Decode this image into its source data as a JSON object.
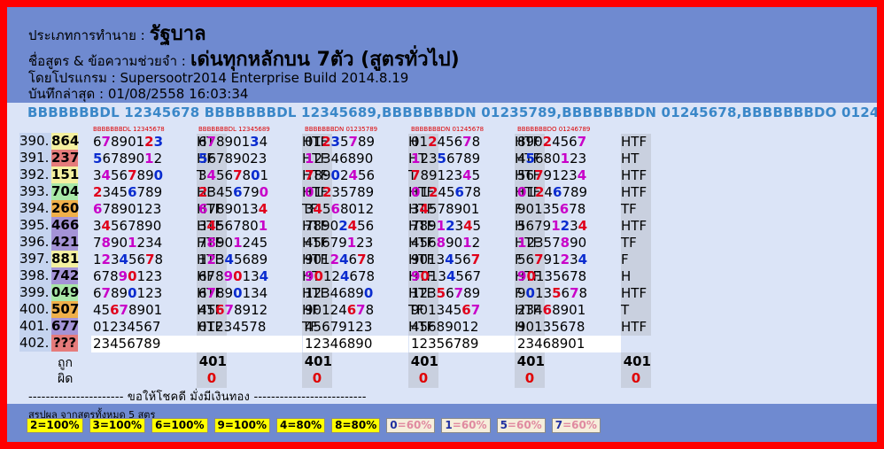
{
  "header": {
    "type_label": "ประเภทการทำนาย :",
    "type_value": "รัฐบาล",
    "formula_label": "ชื่อสูตร & ข้อความช่วยจำ :",
    "formula_value": "เด่นทุกหลักบน 7ตัว (สูตรทั่วไป)",
    "program_label": "โดยโปรแกรม :",
    "program_value": "Supersootr2014 Enterprise Build 2014.8.19",
    "saved_label": "บันทึกล่าสุด :",
    "saved_value": "01/08/2558 16:03:34"
  },
  "formula_line": "BBBBBBBDL 12345678 BBBBBBBDL 12345689,BBBBBBBDN 01235789,BBBBBBBDN 01245678,BBBBBBBDO 01246789",
  "rows": [
    {
      "idx": "390.",
      "pred": "864",
      "color": "#f4f0a0"
    },
    {
      "idx": "391.",
      "pred": "237",
      "color": "#e57b7b"
    },
    {
      "idx": "392.",
      "pred": "151",
      "color": "#f4f0a0"
    },
    {
      "idx": "393.",
      "pred": "704",
      "color": "#a9e8a8"
    },
    {
      "idx": "394.",
      "pred": "260",
      "color": "#f0b04a"
    },
    {
      "idx": "395.",
      "pred": "466",
      "color": "#a493d6"
    },
    {
      "idx": "396.",
      "pred": "421",
      "color": "#a493d6"
    },
    {
      "idx": "397.",
      "pred": "881",
      "color": "#f4f0a0"
    },
    {
      "idx": "398.",
      "pred": "742",
      "color": "#a493d6"
    },
    {
      "idx": "399.",
      "pred": "049",
      "color": "#a9e8a8"
    },
    {
      "idx": "400.",
      "pred": "507",
      "color": "#f0b04a"
    },
    {
      "idx": "401.",
      "pred": "677",
      "color": "#a493d6"
    },
    {
      "idx": "402.",
      "pred": "???",
      "color": "#e57b7b"
    }
  ],
  "columns": [
    {
      "head": "BBBBBBBDL 12345678",
      "digits": [
        "67890123",
        "56789012",
        "34567890",
        "23456789",
        "67890123",
        "34567890",
        "78901234",
        "12345678",
        "67890123",
        "67890123",
        "45678901",
        "01234567",
        "23456789"
      ],
      "results": [
        "HT",
        "HF",
        "T",
        "HF",
        "HTF",
        "HTF",
        "HTF",
        "HTF",
        "HF",
        "HTF",
        "HTF",
        "HTF",
        ""
      ],
      "total": "401",
      "wrong": "0"
    },
    {
      "head": "BBBBBBBDL 12345689",
      "digits": [
        "67890134",
        "56789023",
        "34567801",
        "23456790",
        "67890134",
        "34567801",
        "78901245",
        "12345689",
        "67890134",
        "67890134",
        "45678912",
        "01234578",
        ""
      ],
      "results": [
        "HTF",
        "HTF",
        "HTF",
        "HTF",
        "TF",
        "HTF",
        "HTF",
        "HTF",
        "HT",
        "HTF",
        "HF",
        "TF",
        ""
      ],
      "total": "401",
      "wrong": "0"
    },
    {
      "head": "BBBBBBBDN 01235789",
      "digits": [
        "01235789",
        "12346890",
        "78902456",
        "01235789",
        "34568012",
        "78902456",
        "45679123",
        "90124678",
        "90124678",
        "12346890",
        "90124678",
        "45679123",
        "12346890"
      ],
      "results": [
        "H",
        "HT",
        "T",
        "HTF",
        "HTF",
        "HTF",
        "HTF",
        "HTF",
        "HTF",
        "HTF",
        "TF",
        "HTF",
        ""
      ],
      "total": "401",
      "wrong": "0"
    },
    {
      "head": "BBBBBBBDN 01245678",
      "digits": [
        "01245678",
        "12356789",
        "78912345",
        "01245678",
        "34578901",
        "78912345",
        "45689012",
        "90134567",
        "90134567",
        "12356789",
        "90134567",
        "45689012",
        "12356789"
      ],
      "results": [
        "HTF",
        "HTF",
        "HTF",
        "HTF",
        "F",
        "H",
        "HTF",
        "F",
        "HTF",
        "F",
        "HTF",
        "H",
        ""
      ],
      "total": "401",
      "wrong": "0"
    },
    {
      "head": "BBBBBBBDO 01246789",
      "digits": [
        "89024567",
        "45680123",
        "56791234",
        "01246789",
        "90135678",
        "56791234",
        "12357890",
        "56791234",
        "90135678",
        "90135678",
        "23468901",
        "90135678",
        "23468901"
      ],
      "results": [
        "HTF",
        "HT",
        "HTF",
        "HTF",
        "TF",
        "HTF",
        "TF",
        "F",
        "H",
        "HTF",
        "T",
        "HTF",
        ""
      ],
      "total": "401",
      "wrong": "0"
    }
  ],
  "left_labels": {
    "hit": "ถูก",
    "miss": "ผิด"
  },
  "separator": "---------------------- ขอให้โชคดี มั่งมีเงินทอง --------------------------",
  "summary": {
    "title": "สรุปผล จากสูตรทั้งหมด 5 สูตร",
    "badges": [
      {
        "k": "2",
        "v": "=100%",
        "style": "yellow"
      },
      {
        "k": "3",
        "v": "=100%",
        "style": "yellow"
      },
      {
        "k": "6",
        "v": "=100%",
        "style": "yellow"
      },
      {
        "k": "9",
        "v": "=100%",
        "style": "yellow"
      },
      {
        "k": "4",
        "v": "=80%",
        "style": "yellow"
      },
      {
        "k": "8",
        "v": "=80%",
        "style": "yellow"
      },
      {
        "k": "0",
        "v": "=60%",
        "style": "pale"
      },
      {
        "k": "1",
        "v": "=60%",
        "style": "pale"
      },
      {
        "k": "5",
        "v": "=60%",
        "style": "pale"
      },
      {
        "k": "7",
        "v": "=60%",
        "style": "pale"
      }
    ]
  },
  "colors": {
    "page_border": "#ff0000",
    "header": "#6f8ad0",
    "body": "#dbe4f7",
    "hit_red": "#e0001b",
    "hit_blue": "#0a2ccf",
    "hit_magenta": "#c800c8"
  }
}
